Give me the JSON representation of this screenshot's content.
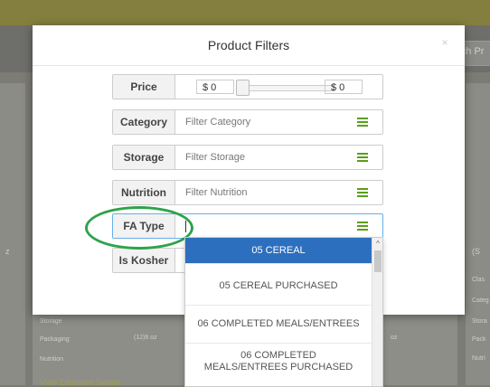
{
  "background": {
    "search_placeholder": "arch Pr",
    "left_edge_text": "z",
    "right_header_text": "(S",
    "right_labels": [
      "Clas",
      "Categ",
      "Stora",
      "Pack",
      "Nutri"
    ],
    "card_labels": [
      "Storage",
      "Packaging",
      "Nutrition"
    ],
    "packaging_value": "(12)6 oz",
    "mid_value": "oz",
    "details_link": "View Extended Details"
  },
  "modal": {
    "title": "Product Filters",
    "close_icon": "×",
    "filters": {
      "price": {
        "label": "Price",
        "min_value": "$ 0",
        "max_value": "$ 0"
      },
      "category": {
        "label": "Category",
        "placeholder": "Filter Category"
      },
      "storage": {
        "label": "Storage",
        "placeholder": "Filter Storage"
      },
      "nutrition": {
        "label": "Nutrition",
        "placeholder": "Filter Nutrition"
      },
      "fa_type": {
        "label": "FA Type",
        "value": ""
      },
      "kosher": {
        "label": "Is Kosher"
      }
    },
    "menu_icon": "hamburger-icon"
  },
  "dropdown": {
    "items": [
      {
        "label": "05 CEREAL",
        "active": true
      },
      {
        "label": "05 CEREAL PURCHASED"
      },
      {
        "label": "06 COMPLETED MEALS/ENTREES"
      },
      {
        "label": "06 COMPLETED MEALS/ENTREES PURCHASED"
      }
    ],
    "scroll_up_icon": "^"
  },
  "colors": {
    "accent_green": "#5b9e1c",
    "annotation_green": "#2da34a",
    "active_blue": "#2d6fbf"
  }
}
